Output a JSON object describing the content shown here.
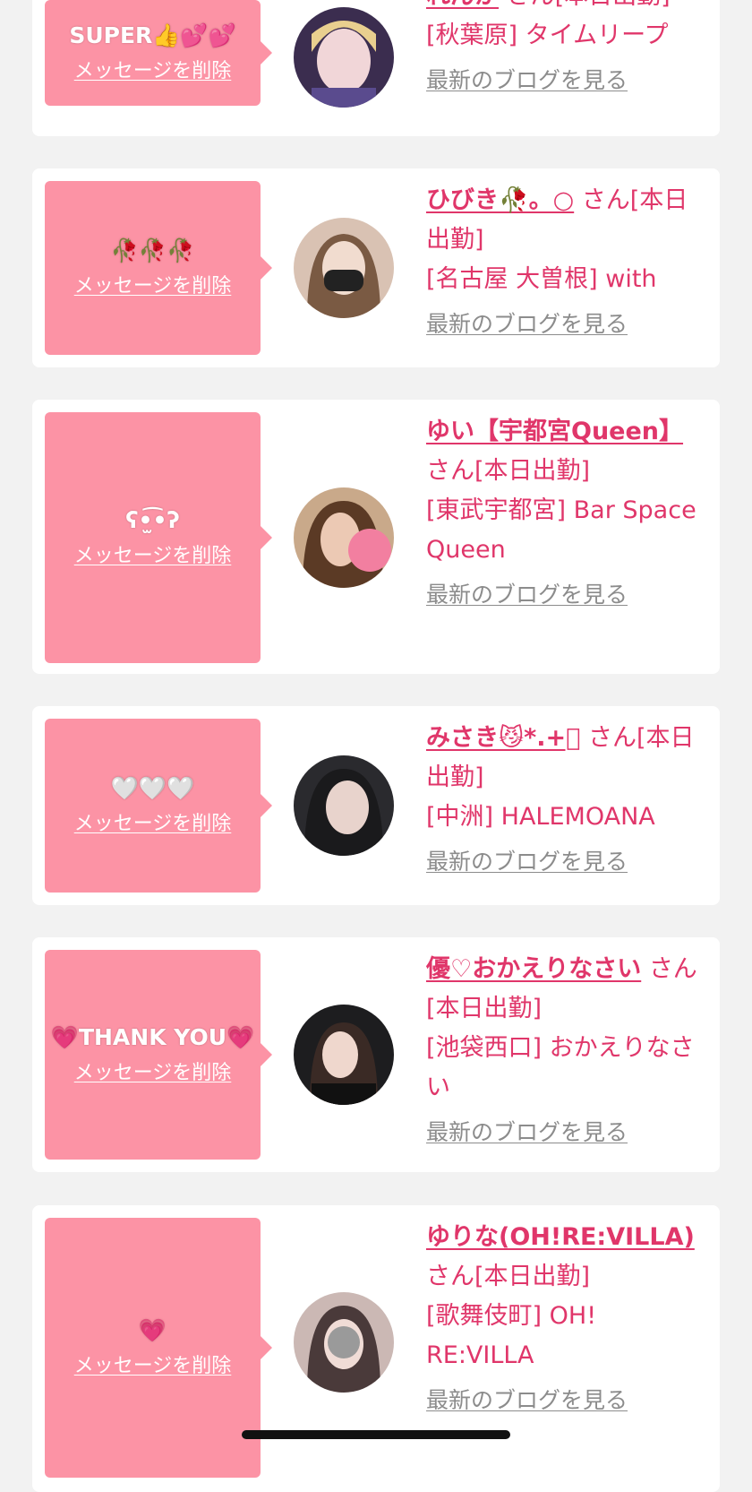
{
  "delete_label": "メッセージを削除",
  "blog_label": "最新のブログを見る",
  "suffix_label": "さん[本日出勤]",
  "colors": {
    "bubble": "#fc93a5",
    "name": "#e0366a",
    "blog_link": "#8c8c8c",
    "page_bg": "#f2f2f2"
  },
  "cards": [
    {
      "message": "SUPER👍💕💕",
      "name": "れんか",
      "shop": "[秋葉原] タイムリープ"
    },
    {
      "message": "🥀🥀🥀",
      "name": "ひびき🥀。○",
      "shop": "[名古屋 大曽根] with"
    },
    {
      "message": "ʕ•̫͡•ʔ",
      "name": "ゆい【宇都宮Queen】",
      "shop": "[東武宇都宮] Bar Space Queen"
    },
    {
      "message": "🤍🤍🤍",
      "name": "みさき😼*.+ﾟ",
      "shop": "[中洲] HALEMOANA"
    },
    {
      "message": "💗THANK YOU💗",
      "name": "優♡おかえりなさい",
      "shop": "[池袋西口] おかえりなさい"
    },
    {
      "message": "💗",
      "name": "ゆりな(OH!RE:VILLA)",
      "shop": "[歌舞伎町] OH! RE:VILLA"
    }
  ]
}
